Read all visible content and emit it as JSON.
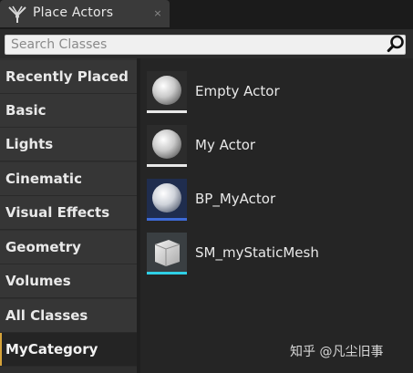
{
  "tab": {
    "title": "Place Actors",
    "close_glyph": "×"
  },
  "search": {
    "placeholder": "Search Classes"
  },
  "sidebar": {
    "items": [
      {
        "label": "Recently Placed"
      },
      {
        "label": "Basic"
      },
      {
        "label": "Lights"
      },
      {
        "label": "Cinematic"
      },
      {
        "label": "Visual Effects"
      },
      {
        "label": "Geometry"
      },
      {
        "label": "Volumes"
      },
      {
        "label": "All Classes"
      },
      {
        "label": "MyCategory",
        "selected": true
      }
    ]
  },
  "assets": [
    {
      "label": "Empty Actor",
      "icon": "sphere-icon",
      "bar_color": "#e8e8e8"
    },
    {
      "label": "My Actor",
      "icon": "sphere-icon",
      "bar_color": "#e8e8e8"
    },
    {
      "label": "BP_MyActor",
      "icon": "sphere-icon",
      "bar_color": "#3e6bd8"
    },
    {
      "label": "SM_myStaticMesh",
      "icon": "cube-mesh-icon",
      "bar_color": "#2fd0e6"
    }
  ],
  "watermark": {
    "text": "知乎 @凡尘旧事"
  },
  "colors": {
    "accent_selected": "#d6a33a",
    "blueprint": "#3e6bd8",
    "static_mesh": "#2fd0e6"
  }
}
